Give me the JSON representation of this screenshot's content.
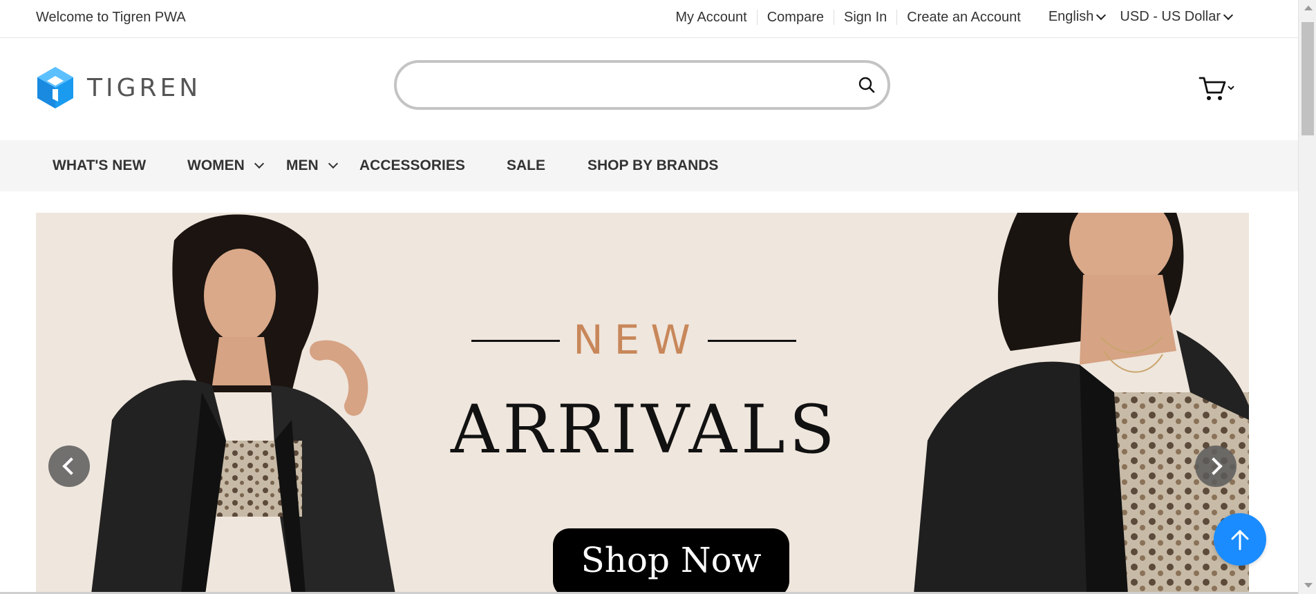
{
  "topbar": {
    "welcome": "Welcome to Tigren PWA",
    "links": [
      "My Account",
      "Compare",
      "Sign In",
      "Create an Account"
    ],
    "language": "English",
    "currency": "USD - US Dollar"
  },
  "header": {
    "logo_text": "TIGREN",
    "search_placeholder": "",
    "brand_color": "#1a9bf0"
  },
  "nav": {
    "items": [
      {
        "label": "WHAT'S NEW",
        "has_dropdown": false
      },
      {
        "label": "WOMEN",
        "has_dropdown": true
      },
      {
        "label": "MEN",
        "has_dropdown": true
      },
      {
        "label": "ACCESSORIES",
        "has_dropdown": false
      },
      {
        "label": "SALE",
        "has_dropdown": false
      },
      {
        "label": "SHOP BY BRANDS",
        "has_dropdown": false
      }
    ]
  },
  "banner": {
    "tagline": "NEW",
    "headline": "ARRIVALS",
    "cta": "Shop Now",
    "background": "#efe6dd",
    "accent": "#c8875a"
  },
  "icons": {
    "search": "search-icon",
    "cart": "cart-icon",
    "prev": "chevron-left-icon",
    "next": "chevron-right-icon",
    "to_top": "arrow-up-icon"
  },
  "colors": {
    "nav_background": "#f5f5f5",
    "to_top_button": "#1a8cff"
  }
}
